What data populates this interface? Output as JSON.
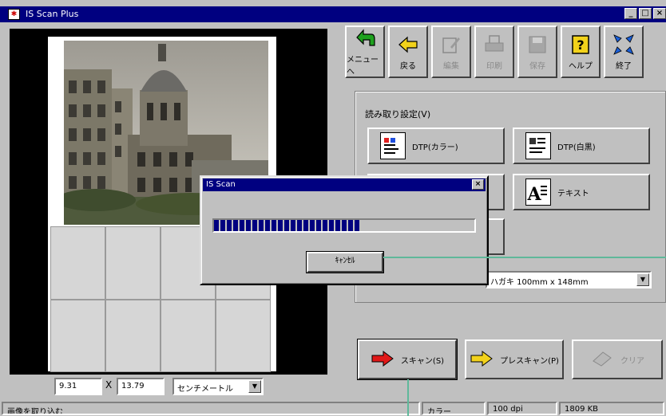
{
  "window": {
    "title": "IS Scan Plus",
    "controls": [
      "_",
      "□",
      "×"
    ]
  },
  "toolbar": [
    {
      "label": "メニューへ",
      "icon": "menu-back-icon",
      "enabled": true
    },
    {
      "label": "戻る",
      "icon": "back-arrow-icon",
      "enabled": true
    },
    {
      "label": "編集",
      "icon": "edit-icon",
      "enabled": false
    },
    {
      "label": "印刷",
      "icon": "print-icon",
      "enabled": false
    },
    {
      "label": "保存",
      "icon": "save-icon",
      "enabled": false
    },
    {
      "label": "ヘルプ",
      "icon": "help-icon",
      "enabled": true
    },
    {
      "label": "終了",
      "icon": "exit-icon",
      "enabled": true
    }
  ],
  "settings": {
    "group_title": "読み取り設定(V)",
    "modes": [
      {
        "label": "DTP(カラー)"
      },
      {
        "label": "DTP(白黒)"
      },
      {
        "label": "テキスト"
      }
    ],
    "paper_size": "ハガキ 100mm x 148mm"
  },
  "actions": {
    "scan": "スキャン(S)",
    "prescan": "プレスキャン(P)",
    "clear": "クリア"
  },
  "coords": {
    "x": "9.31",
    "separator": "X",
    "y": "13.79",
    "unit": "センチメートル"
  },
  "status": {
    "message": "画像を取り込む",
    "color_mode": "カラー",
    "resolution": "100 dpi",
    "file_size": "1809 KB"
  },
  "dialog": {
    "title": "IS Scan",
    "progress": 0.56,
    "cancel": "ｷｬﾝｾﾙ"
  },
  "colors": {
    "titlebar": "#000080",
    "face": "#c0c0c0",
    "callout": "#5fb89a"
  }
}
